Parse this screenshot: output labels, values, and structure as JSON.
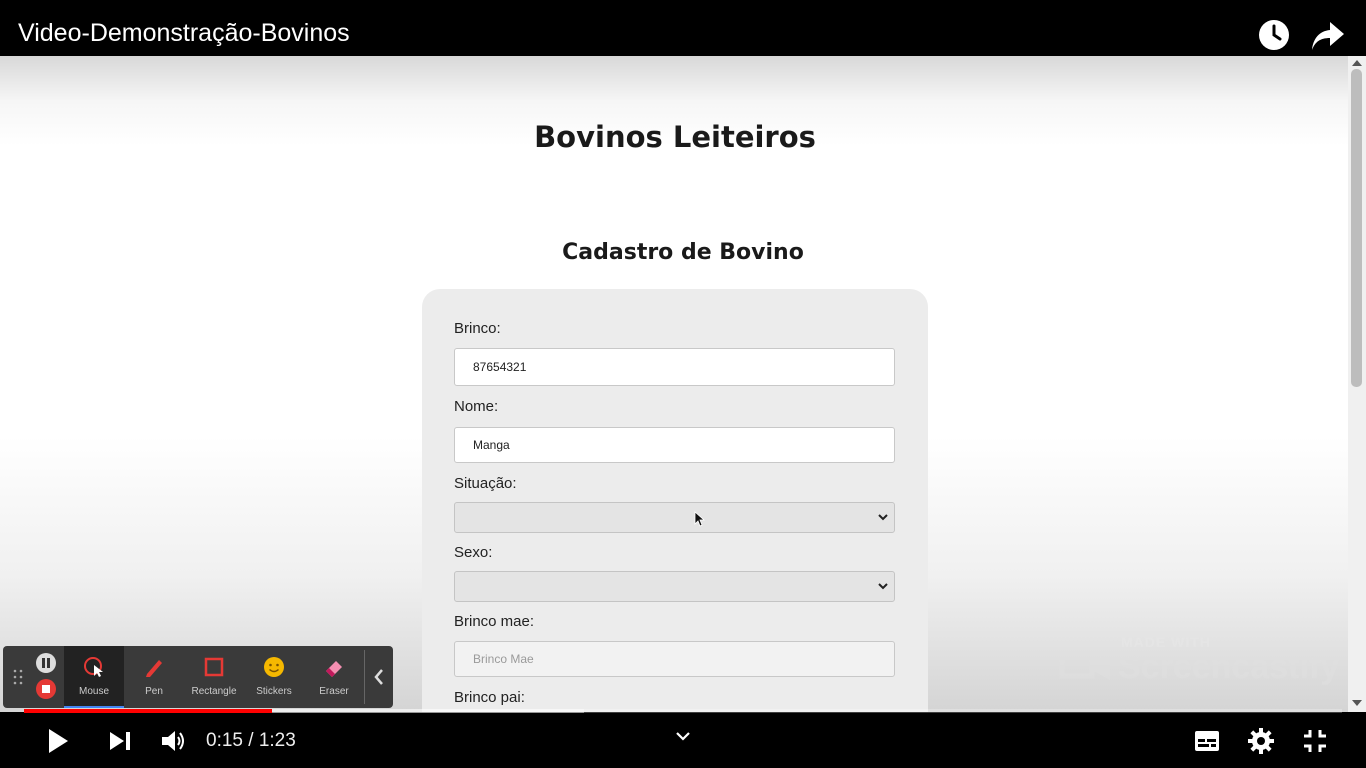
{
  "player": {
    "title": "Video-Demonstração-Bovinos",
    "current_time": "0:15",
    "time_separator": " / ",
    "duration": "1:23",
    "progress": {
      "played_fraction": 0.188,
      "buffered_fraction": 0.425
    },
    "accent_color": "#ff0000",
    "icons": [
      "watch-later-icon",
      "share-icon",
      "play-icon",
      "next-icon",
      "volume-icon",
      "chevron-down-icon",
      "subtitles-icon",
      "settings-icon",
      "exit-fullscreen-icon"
    ]
  },
  "page": {
    "heading": "Bovinos Leiteiros",
    "form_title": "Cadastro de Bovino",
    "fields": {
      "brinco": {
        "label": "Brinco:",
        "value": "87654321"
      },
      "nome": {
        "label": "Nome:",
        "value": "Manga"
      },
      "situacao": {
        "label": "Situação:",
        "value": ""
      },
      "sexo": {
        "label": "Sexo:",
        "value": ""
      },
      "brinco_mae": {
        "label": "Brinco mae:",
        "placeholder": "Brinco Mae"
      },
      "brinco_pai": {
        "label": "Brinco pai:"
      }
    }
  },
  "watermark": {
    "small": "MADE WITH",
    "big": "Screencastify"
  },
  "screencastify_toolbar": {
    "tools": [
      {
        "label": "Mouse",
        "icon": "mouse-icon",
        "active": true
      },
      {
        "label": "Pen",
        "icon": "pen-icon",
        "active": false
      },
      {
        "label": "Rectangle",
        "icon": "rectangle-icon",
        "active": false
      },
      {
        "label": "Stickers",
        "icon": "sticker-icon",
        "active": false
      },
      {
        "label": "Eraser",
        "icon": "eraser-icon",
        "active": false
      }
    ]
  }
}
